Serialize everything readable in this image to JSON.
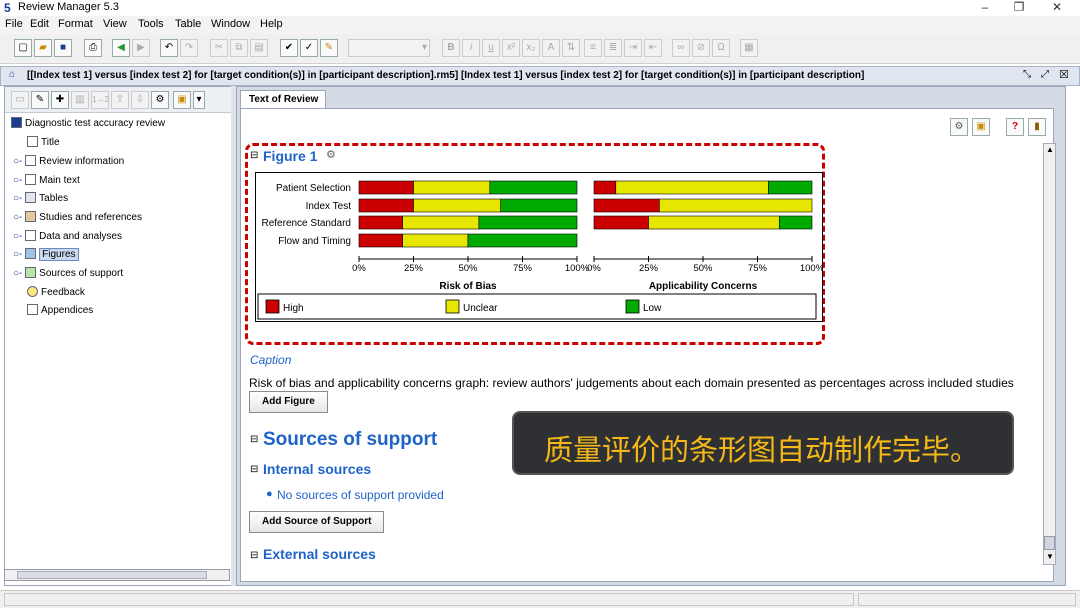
{
  "window": {
    "title": "Review Manager 5.3",
    "controls": {
      "minimize": "–",
      "maximize": "❐",
      "close": "✕"
    }
  },
  "menu": [
    "File",
    "Edit",
    "Format",
    "View",
    "Tools",
    "Table",
    "Window",
    "Help"
  ],
  "document_title": "[[Index test 1] versus [index test 2] for [target condition(s)] in [participant description].rm5] [Index test 1] versus [index test 2] for [target condition(s)] in [participant description]",
  "tree": {
    "root": "Diagnostic test accuracy review",
    "items": [
      {
        "label": "Title",
        "icon": "page-icon"
      },
      {
        "label": "Review information",
        "icon": "info-doc-icon"
      },
      {
        "label": "Main text",
        "icon": "text-doc-icon"
      },
      {
        "label": "Tables",
        "icon": "table-icon"
      },
      {
        "label": "Studies and references",
        "icon": "books-icon"
      },
      {
        "label": "Data and analyses",
        "icon": "analysis-icon"
      },
      {
        "label": "Figures",
        "icon": "figure-icon",
        "selected": true
      },
      {
        "label": "Sources of support",
        "icon": "support-icon"
      },
      {
        "label": "Feedback",
        "icon": "feedback-icon"
      },
      {
        "label": "Appendices",
        "icon": "appendix-icon"
      }
    ]
  },
  "tab": {
    "label": "Text of Review"
  },
  "figure": {
    "heading": "Figure 1",
    "caption_label": "Caption",
    "caption_text": "Risk of bias and applicability concerns graph: review authors' judgements about each domain presented as percentages across included studies",
    "add_button": "Add Figure"
  },
  "chart_data": [
    {
      "type": "bar",
      "stacked": true,
      "orientation": "horizontal",
      "title": "Risk of Bias",
      "categories": [
        "Patient Selection",
        "Index Test",
        "Reference Standard",
        "Flow and Timing"
      ],
      "series": [
        {
          "name": "High",
          "values": [
            25,
            25,
            20,
            20
          ]
        },
        {
          "name": "Unclear",
          "values": [
            35,
            40,
            35,
            30
          ]
        },
        {
          "name": "Low",
          "values": [
            40,
            35,
            45,
            50
          ]
        }
      ],
      "xlim": [
        0,
        100
      ],
      "xticks": [
        "0%",
        "25%",
        "50%",
        "75%",
        "100%"
      ]
    },
    {
      "type": "bar",
      "stacked": true,
      "orientation": "horizontal",
      "title": "Applicability Concerns",
      "categories": [
        "Patient Selection",
        "Index Test",
        "Reference Standard"
      ],
      "series": [
        {
          "name": "High",
          "values": [
            10,
            30,
            25
          ]
        },
        {
          "name": "Unclear",
          "values": [
            70,
            70,
            60
          ]
        },
        {
          "name": "Low",
          "values": [
            20,
            0,
            15
          ]
        }
      ],
      "xlim": [
        0,
        100
      ],
      "xticks": [
        "0%",
        "25%",
        "50%",
        "75%",
        "100%"
      ]
    }
  ],
  "legend": [
    {
      "label": "High",
      "color": "#cc0000"
    },
    {
      "label": "Unclear",
      "color": "#e6e600"
    },
    {
      "label": "Low",
      "color": "#00aa00"
    }
  ],
  "sources": {
    "heading": "Sources of support",
    "internal_heading": "Internal sources",
    "internal_item": "No sources of support provided",
    "add_button": "Add Source of Support",
    "external_heading": "External sources"
  },
  "overlay_text": "质量评价的条形图自动制作完毕。",
  "colors": {
    "high": "#cc0000",
    "unclear": "#e6e600",
    "low": "#00aa00",
    "accent": "#1e63c8"
  }
}
